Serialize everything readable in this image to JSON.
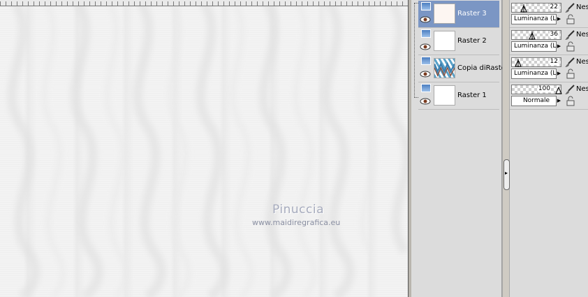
{
  "canvas": {
    "watermark_title": "Pinuccia",
    "watermark_url": "www.maidiregrafica.eu"
  },
  "layers": [
    {
      "name": "Raster 3",
      "selected": true,
      "thumbnail": "warm-white"
    },
    {
      "name": "Raster 2",
      "selected": false,
      "thumbnail": "white"
    },
    {
      "name": "Copia diRaster",
      "selected": false,
      "thumbnail": "zigzag-pattern"
    },
    {
      "name": "Raster 1",
      "selected": false,
      "thumbnail": "white"
    }
  ],
  "properties": [
    {
      "opacity": "22",
      "blend_mode": "Luminanza (L)",
      "mask": "Nes"
    },
    {
      "opacity": "36",
      "blend_mode": "Luminanza (L)",
      "mask": "Nes"
    },
    {
      "opacity": "12",
      "blend_mode": "Luminanza (L)",
      "mask": "Nes"
    },
    {
      "opacity": "100",
      "blend_mode": "Normale",
      "mask": "Nes"
    }
  ],
  "colors": {
    "selected_layer": "#7b96c4",
    "panel_bg": "#dcdcdc",
    "watermark": "#a6abbd"
  },
  "icons": {
    "layer_type": "raster-layer-icon",
    "visibility": "eye-icon",
    "brush": "paintbrush-icon",
    "lock": "lock-icon",
    "collapse": "chevron-right-icon"
  }
}
